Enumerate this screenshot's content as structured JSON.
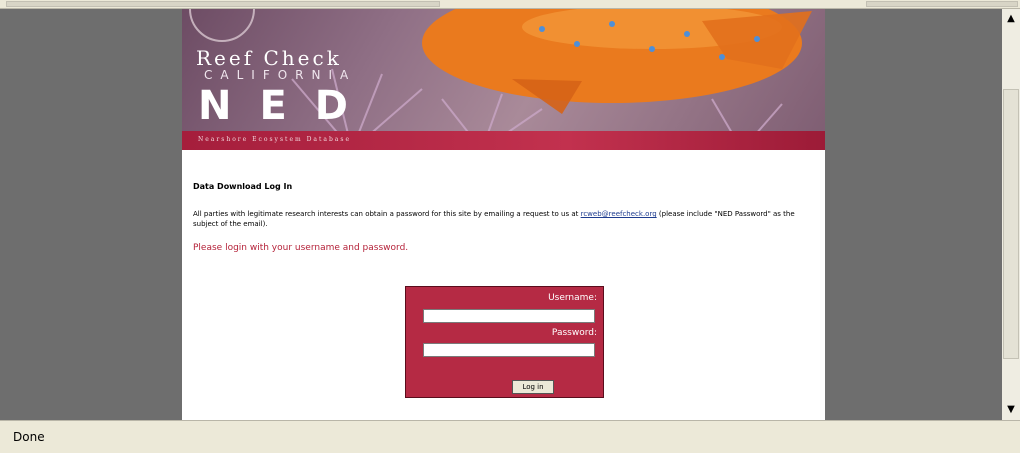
{
  "banner": {
    "brand_line1": "Reef Check",
    "brand_line2": "CALIFORNIA",
    "brand_line3": "NED",
    "strip_text": "Nearshore Ecosystem Database"
  },
  "content": {
    "heading": "Data Download Log In",
    "paragraph_prefix": "All parties with legitimate research interests can obtain a password for this site by emailing a request to us at ",
    "email_link": "rcweb@reefcheck.org",
    "paragraph_suffix": " (please include \"NED Password\" as the subject of the email).",
    "prompt": "Please login with your username and password."
  },
  "login": {
    "username_label": "Username:",
    "username_value": "",
    "password_label": "Password:",
    "password_value": "",
    "button_label": "Log in"
  },
  "status": {
    "text": "Done"
  },
  "colors": {
    "accent": "#b52a44",
    "link": "#1e3c8f",
    "page_bg": "#6e6e6e"
  }
}
